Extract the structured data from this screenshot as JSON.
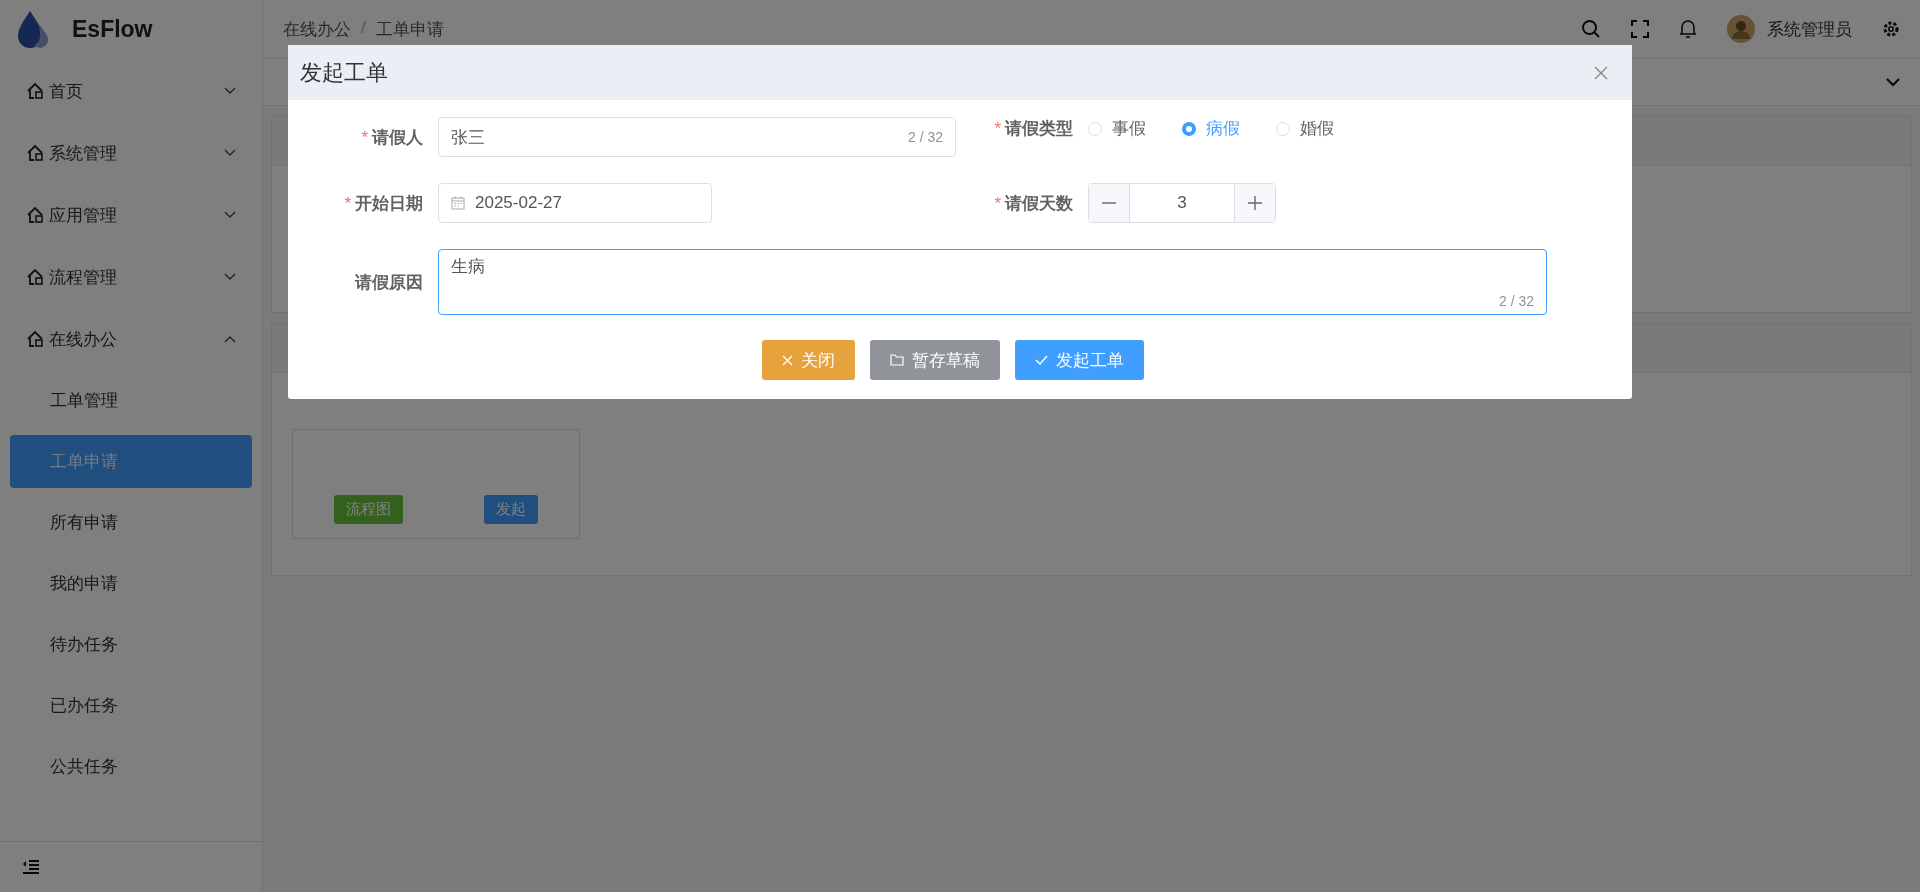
{
  "app": {
    "name": "EsFlow"
  },
  "sidebar": {
    "items": [
      {
        "label": "首页",
        "expanded": false
      },
      {
        "label": "系统管理",
        "expanded": false
      },
      {
        "label": "应用管理",
        "expanded": false
      },
      {
        "label": "流程管理",
        "expanded": false
      },
      {
        "label": "在线办公",
        "expanded": true,
        "children": [
          {
            "label": "工单管理",
            "selected": false
          },
          {
            "label": "工单申请",
            "selected": true
          },
          {
            "label": "所有申请",
            "selected": false
          },
          {
            "label": "我的申请",
            "selected": false
          },
          {
            "label": "待办任务",
            "selected": false
          },
          {
            "label": "已办任务",
            "selected": false
          },
          {
            "label": "公共任务",
            "selected": false
          }
        ]
      }
    ]
  },
  "breadcrumb": {
    "separator": "/",
    "items": [
      "在线办公",
      "工单申请"
    ]
  },
  "header": {
    "user": "系统管理员"
  },
  "cards": [
    {
      "buttons": [
        {
          "label": "流程图",
          "kind": "success"
        },
        {
          "label": "发起",
          "kind": "primary"
        }
      ]
    }
  ],
  "dialog": {
    "title": "发起工单",
    "required_mark": "*",
    "rows": [
      [
        {
          "kind": "text",
          "label": "请假人",
          "required": true,
          "value": "张三",
          "counter": "2 / 32"
        },
        {
          "kind": "radio",
          "label": "请假类型",
          "required": true,
          "options": [
            {
              "label": "事假",
              "selected": false
            },
            {
              "label": "病假",
              "selected": true
            },
            {
              "label": "婚假",
              "selected": false
            }
          ]
        }
      ],
      [
        {
          "kind": "date",
          "label": "开始日期",
          "required": true,
          "value": "2025-02-27"
        },
        {
          "kind": "number",
          "label": "请假天数",
          "required": true,
          "value": "3"
        }
      ],
      [
        {
          "kind": "textarea",
          "label": "请假原因",
          "required": false,
          "value": "生病",
          "counter": "2 / 32",
          "focused": true
        }
      ]
    ],
    "buttons": [
      {
        "label": "关闭",
        "kind": "warning"
      },
      {
        "label": "暂存草稿",
        "kind": "info"
      },
      {
        "label": "发起工单",
        "kind": "primary"
      }
    ]
  }
}
